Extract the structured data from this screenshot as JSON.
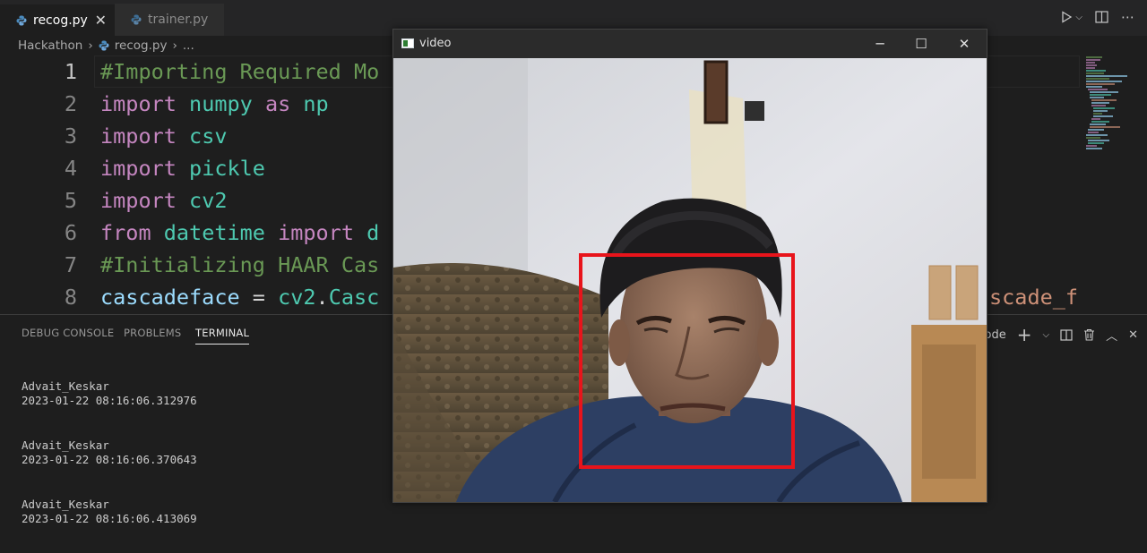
{
  "tabs": [
    {
      "label": "recog.py",
      "active": true
    },
    {
      "label": "trainer.py",
      "active": false
    }
  ],
  "breadcrumb": {
    "folder": "Hackathon",
    "file": "recog.py",
    "more": "..."
  },
  "editor": {
    "lines": [
      {
        "n": "1",
        "tokens": [
          [
            "cmt",
            "#Importing Required Mo"
          ]
        ]
      },
      {
        "n": "2",
        "tokens": [
          [
            "kw",
            "import"
          ],
          [
            "op",
            " "
          ],
          [
            "mod",
            "numpy"
          ],
          [
            "op",
            " "
          ],
          [
            "kw",
            "as"
          ],
          [
            "op",
            " "
          ],
          [
            "mod",
            "np"
          ]
        ]
      },
      {
        "n": "3",
        "tokens": [
          [
            "kw",
            "import"
          ],
          [
            "op",
            " "
          ],
          [
            "mod",
            "csv"
          ]
        ]
      },
      {
        "n": "4",
        "tokens": [
          [
            "kw",
            "import"
          ],
          [
            "op",
            " "
          ],
          [
            "mod",
            "pickle"
          ]
        ]
      },
      {
        "n": "5",
        "tokens": [
          [
            "kw",
            "import"
          ],
          [
            "op",
            " "
          ],
          [
            "mod",
            "cv2"
          ]
        ]
      },
      {
        "n": "6",
        "tokens": [
          [
            "kw",
            "from"
          ],
          [
            "op",
            " "
          ],
          [
            "mod",
            "datetime"
          ],
          [
            "op",
            " "
          ],
          [
            "kw",
            "import"
          ],
          [
            "op",
            " "
          ],
          [
            "mod",
            "d"
          ]
        ]
      },
      {
        "n": "7",
        "tokens": [
          [
            "cmt",
            "#Initializing HAAR Cas"
          ]
        ]
      },
      {
        "n": "8",
        "tokens": [
          [
            "var",
            "cascadeface"
          ],
          [
            "op",
            " = "
          ],
          [
            "mod",
            "cv2"
          ],
          [
            "op",
            "."
          ],
          [
            "mod",
            "Casc"
          ]
        ]
      }
    ],
    "overflow_text": "scade_f"
  },
  "panel": {
    "tabs": [
      "DEBUG CONSOLE",
      "PROBLEMS",
      "TERMINAL"
    ],
    "active_tab": "TERMINAL",
    "shell_label": "Code",
    "terminal_entries": [
      {
        "name": "Advait_Keskar",
        "time": "2023-01-22 08:16:06.312976"
      },
      {
        "name": "Advait_Keskar",
        "time": "2023-01-22 08:16:06.370643"
      },
      {
        "name": "Advait_Keskar",
        "time": "2023-01-22 08:16:06.413069"
      }
    ]
  },
  "video_window": {
    "title": "video",
    "minimize": "─",
    "maximize": "☐",
    "close": "✕"
  },
  "colors": {
    "accent_face_box": "#e8141b",
    "comment": "#6a9955",
    "keyword": "#c586c0",
    "module": "#4ec9b0",
    "variable": "#9cdcfe"
  },
  "icons": {
    "tab_file": "python-file-icon",
    "run": "play-icon",
    "split": "split-editor-icon",
    "more": "ellipsis-icon"
  }
}
